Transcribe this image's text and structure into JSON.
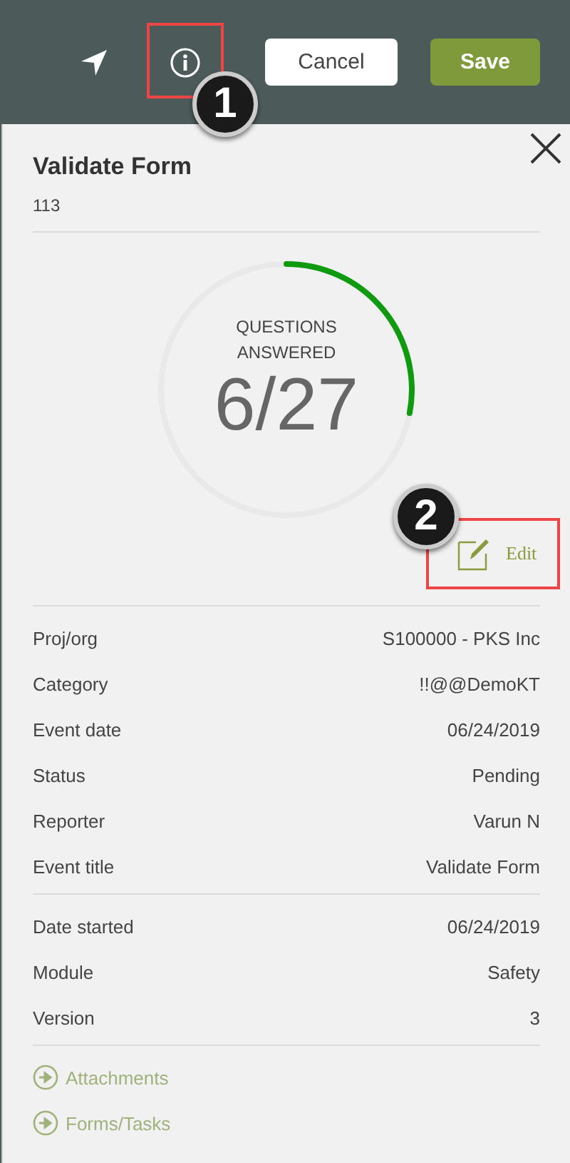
{
  "header": {
    "cancel": "Cancel",
    "save": "Save"
  },
  "annotations": [
    {
      "number": "1"
    },
    {
      "number": "2"
    }
  ],
  "panel": {
    "title": "Validate Form",
    "subtitle": "113"
  },
  "progress": {
    "label": "QUESTIONS ANSWERED",
    "value": "6/27"
  },
  "edit": {
    "label": "Edit"
  },
  "details": [
    {
      "label": "Proj/org",
      "value": "S100000 - PKS Inc"
    },
    {
      "label": "Category",
      "value": "!!@@DemoKT"
    },
    {
      "label": "Event date",
      "value": "06/24/2019"
    },
    {
      "label": "Status",
      "value": "Pending"
    },
    {
      "label": "Reporter",
      "value": "Varun N"
    },
    {
      "label": "Event title",
      "value": "Validate Form"
    }
  ],
  "meta": [
    {
      "label": "Date started",
      "value": "06/24/2019"
    },
    {
      "label": "Module",
      "value": "Safety"
    },
    {
      "label": "Version",
      "value": "3"
    }
  ],
  "links": [
    {
      "label": "Attachments",
      "disabled": true
    },
    {
      "label": "Forms/Tasks",
      "disabled": true
    }
  ]
}
